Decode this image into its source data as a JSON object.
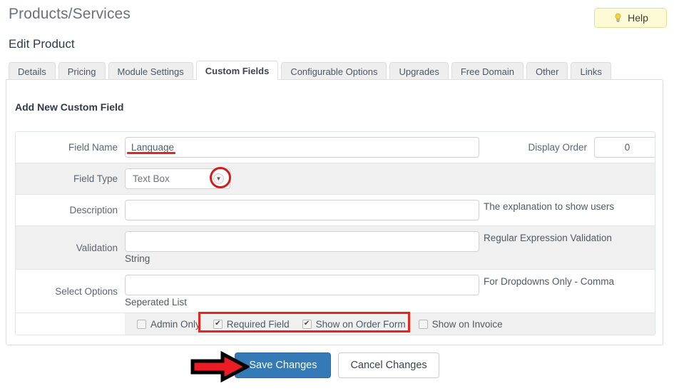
{
  "header": {
    "page_title": "Products/Services",
    "section_title": "Edit Product",
    "help_label": "Help",
    "help_icon": "lightbulb-icon",
    "help_bg": "#fdfbd6",
    "help_border": "#e7dd94"
  },
  "tabs": [
    {
      "label": "Details",
      "active": false
    },
    {
      "label": "Pricing",
      "active": false
    },
    {
      "label": "Module Settings",
      "active": false
    },
    {
      "label": "Custom Fields",
      "active": true
    },
    {
      "label": "Configurable Options",
      "active": false
    },
    {
      "label": "Upgrades",
      "active": false
    },
    {
      "label": "Free Domain",
      "active": false
    },
    {
      "label": "Other",
      "active": false
    },
    {
      "label": "Links",
      "active": false
    }
  ],
  "panel": {
    "heading": "Add New Custom Field",
    "rows": {
      "field_name": {
        "label": "Field Name",
        "value": "Language",
        "placeholder": ""
      },
      "display_order": {
        "label": "Display Order",
        "value": "0"
      },
      "field_type": {
        "label": "Field Type",
        "value": "Text Box",
        "caret_icon": "chevron-down-icon"
      },
      "description": {
        "label": "Description",
        "value": "",
        "help": "The explanation to show users"
      },
      "validation": {
        "label": "Validation",
        "value": "",
        "help": "Regular Expression Validation",
        "help_below": "String"
      },
      "select_options": {
        "label": "Select Options",
        "value": "",
        "help": "For Dropdowns Only - Comma",
        "help_below": "Seperated List"
      }
    },
    "checkboxes": [
      {
        "label": "Admin Only",
        "checked": false
      },
      {
        "label": "Required Field",
        "checked": true
      },
      {
        "label": "Show on Order Form",
        "checked": true
      },
      {
        "label": "Show on Invoice",
        "checked": false
      }
    ],
    "checkmark_glyph": "✔"
  },
  "footer": {
    "save_label": "Save Changes",
    "cancel_label": "Cancel Changes",
    "primary_color": "#337ab7"
  },
  "annotations": {
    "underline_color": "#e8241f",
    "circle_color": "#d21c1c",
    "rect_color": "#e8241f",
    "arrow_fill": "#ed1c24",
    "arrow_stroke": "#000000"
  }
}
